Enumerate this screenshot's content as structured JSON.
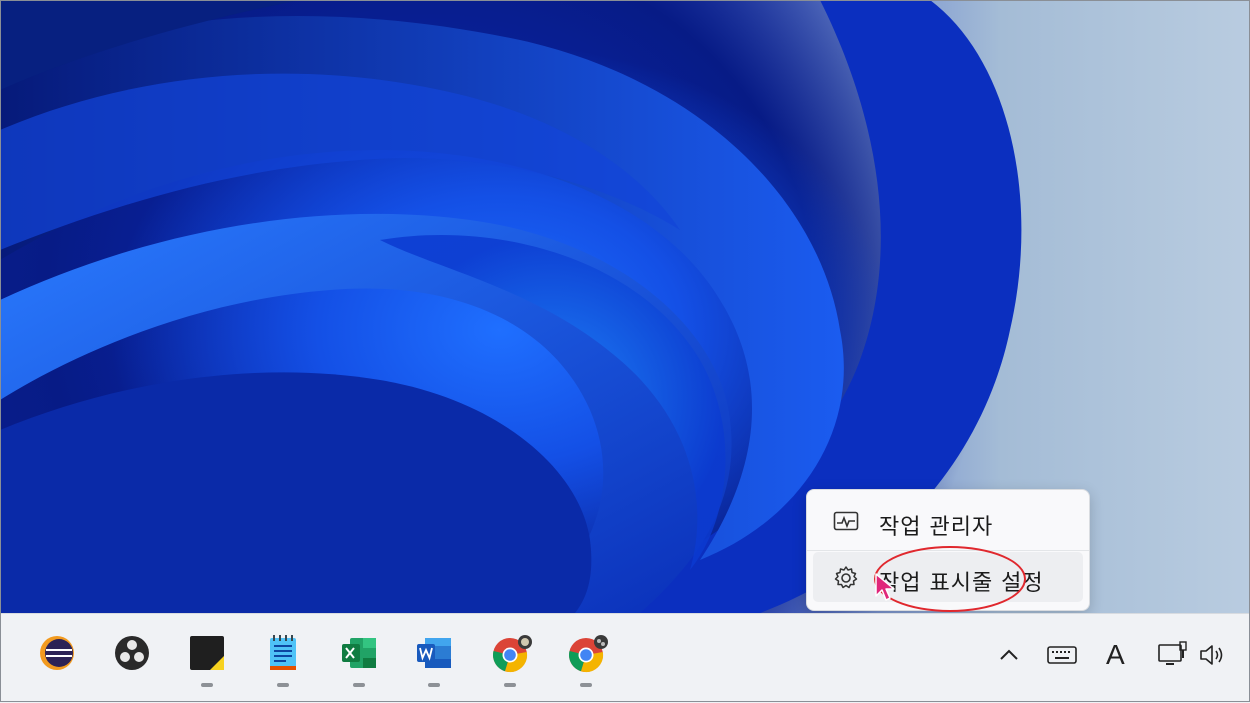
{
  "context_menu": {
    "items": [
      {
        "label": "작업 관리자",
        "icon": "task-manager-icon"
      },
      {
        "label": "작업 표시줄 설정",
        "icon": "gear-icon"
      }
    ]
  },
  "taskbar": {
    "apps": [
      {
        "name": "eclipse",
        "icon": "eclipse-icon"
      },
      {
        "name": "obs-studio",
        "icon": "obs-icon"
      },
      {
        "name": "sticky-notes",
        "icon": "sticky-notes-icon"
      },
      {
        "name": "notepad",
        "icon": "notepad-icon"
      },
      {
        "name": "excel",
        "icon": "excel-icon"
      },
      {
        "name": "word",
        "icon": "word-icon"
      },
      {
        "name": "chrome-profile-1",
        "icon": "chrome-icon"
      },
      {
        "name": "chrome-profile-2",
        "icon": "chrome-icon"
      }
    ],
    "tray": {
      "input_indicator": "A"
    }
  },
  "colors": {
    "highlight": "#e0282e",
    "cursor": "#e0267a",
    "excel": "#1d7a45",
    "word": "#2b5cc9"
  }
}
